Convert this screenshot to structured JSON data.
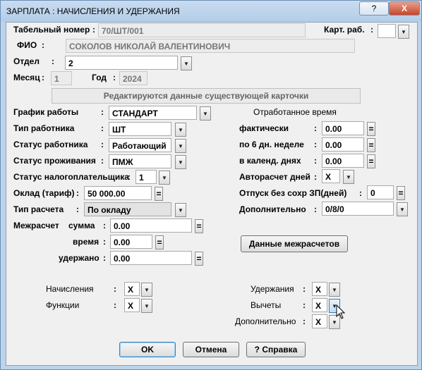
{
  "window": {
    "title": "ЗАРПЛАТА : НАЧИСЛЕНИЯ И УДЕРЖАНИЯ",
    "help_label": "?",
    "close_label": "X"
  },
  "header": {
    "tab_label": "Табельный номер",
    "tab_value": "70/ШТ/001",
    "card_label": "Карт. раб.",
    "card_value": "",
    "fio_label": "ФИО",
    "fio_value": "СОКОЛОВ НИКОЛАЙ ВАЛЕНТИНОВИЧ",
    "otdel_label": "Отдел",
    "otdel_value": "2",
    "month_label": "Месяц",
    "month_value": "1",
    "year_label": "Год",
    "year_value": "2024",
    "banner": "Редактируются данные существующей карточки"
  },
  "left": {
    "grafik_label": "График работы",
    "grafik_value": "СТАНДАРТ",
    "tip_label": "Тип работника",
    "tip_value": "ШТ",
    "status_label": "Статус работника",
    "status_value": "Работающий",
    "prozh_label": "Статус проживания",
    "prozh_value": "ПМЖ",
    "nalog_label": "Статус налогоплательщика",
    "nalog_value": "1",
    "oklad_label": "Оклад (тариф)",
    "oklad_value": "50 000.00",
    "raschet_label": "Тип расчета",
    "raschet_value": "По окладу",
    "mezh_label": "Межрасчет",
    "summa_label": "сумма",
    "summa_value": "0.00",
    "vremya_label": "время",
    "vremya_value": "0.00",
    "uderzh_label": "удержано",
    "uderzh_value": "0.00"
  },
  "right": {
    "section_title": "Отработанное время",
    "fakt_label": "фактически",
    "fakt_value": "0.00",
    "six_label": "по 6 дн. неделе",
    "six_value": "0.00",
    "kal_label": "в календ. днях",
    "kal_value": "0.00",
    "auto_label": "Авторасчет дней",
    "auto_value": "X",
    "otpusk_label": "Отпуск без сохр ЗП(дней)",
    "otpusk_value": "0",
    "dop_label": "Дополнительно",
    "dop_value": "0/8/0",
    "mezh_button": "Данные межрасчетов"
  },
  "bottom": {
    "nach_label": "Начисления",
    "nach_value": "X",
    "func_label": "Функции",
    "func_value": "X",
    "uder_label": "Удержания",
    "uder_value": "X",
    "vych_label": "Вычеты",
    "vych_value": "X",
    "dop_label": "Дополнительно",
    "dop_value": "X"
  },
  "buttons": {
    "ok": "OK",
    "cancel": "Отмена",
    "help": "? Справка"
  },
  "glyphs": {
    "colon": ":",
    "dd_arrow": "▼",
    "eq": "="
  }
}
